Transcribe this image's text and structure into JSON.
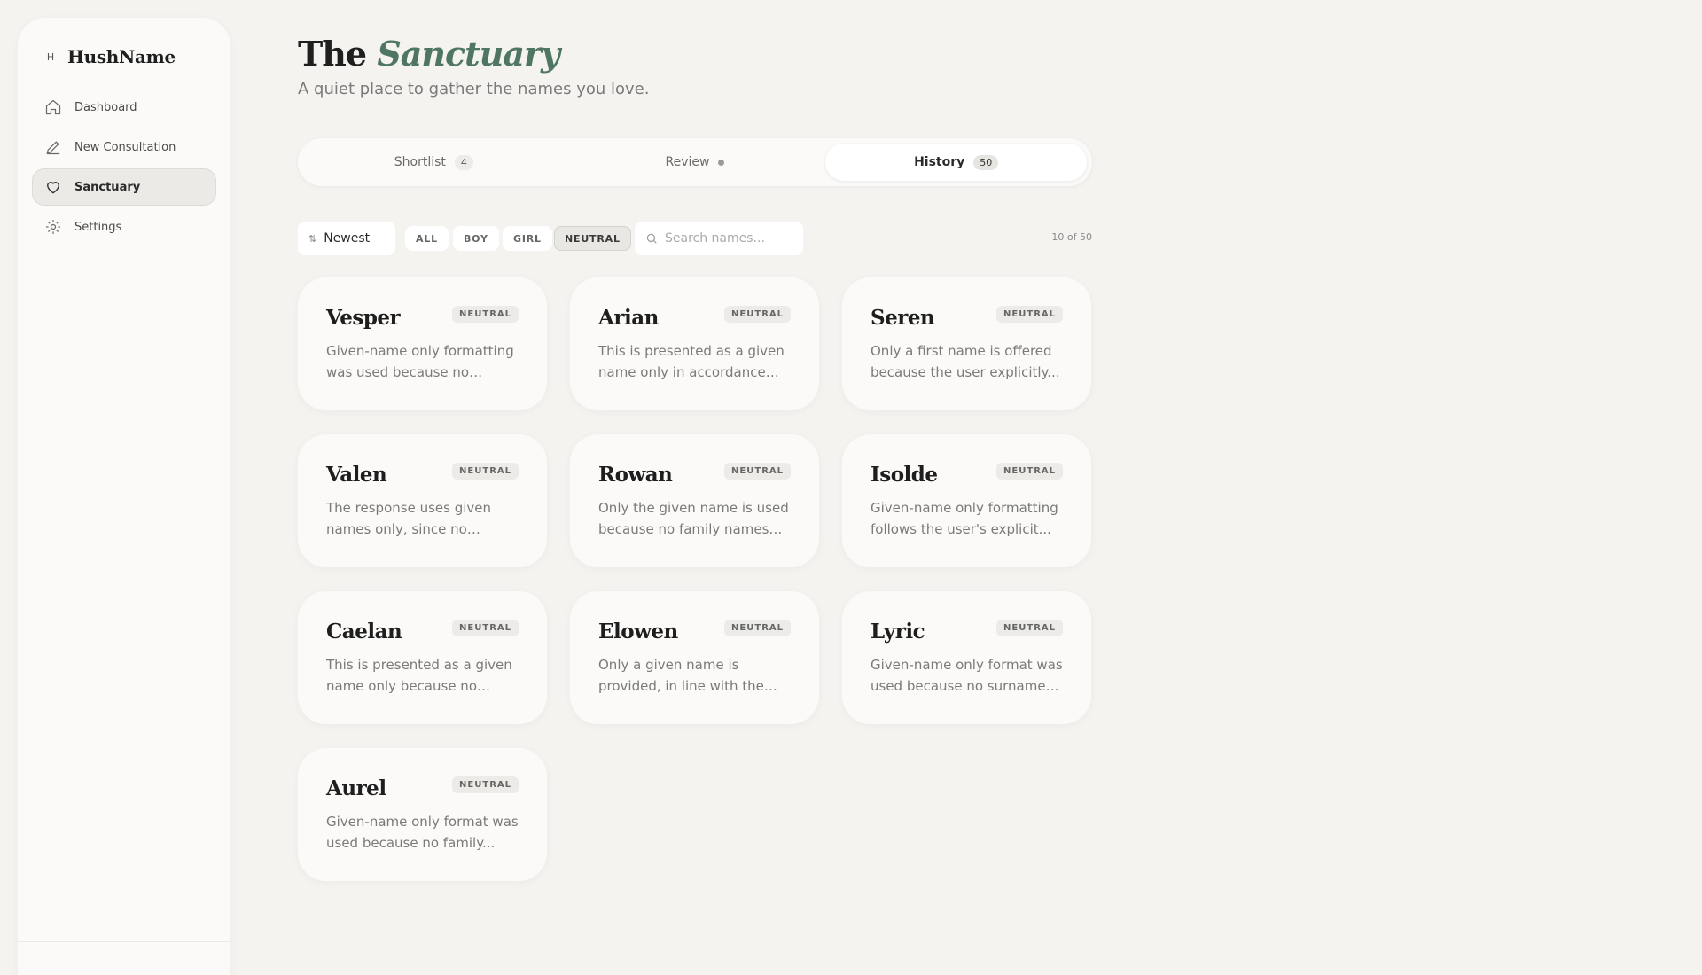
{
  "brand": {
    "mark": "H",
    "name": "HushName"
  },
  "nav": [
    {
      "label": "Dashboard",
      "icon": "home-icon"
    },
    {
      "label": "New Consultation",
      "icon": "pencil-icon"
    },
    {
      "label": "Sanctuary",
      "icon": "heart-icon",
      "active": true
    },
    {
      "label": "Settings",
      "icon": "gear-icon"
    }
  ],
  "header": {
    "title_prefix": "The",
    "title_accent": "Sanctuary",
    "subtitle": "A quiet place to gather the names you love."
  },
  "tabs": [
    {
      "label": "Shortlist",
      "count": "4"
    },
    {
      "label": "Review",
      "indicator": "dot"
    },
    {
      "label": "History",
      "count": "50",
      "active": true
    }
  ],
  "toolbar": {
    "sort_label": "Newest",
    "filters": [
      "ALL",
      "BOY",
      "GIRL",
      "NEUTRAL"
    ],
    "active_filter": "NEUTRAL",
    "search_placeholder": "Search names...",
    "count_text": "10 of 50"
  },
  "cards": [
    {
      "name": "Vesper",
      "badge": "NEUTRAL",
      "desc": "Given-name only formatting was used because no family..."
    },
    {
      "name": "Arian",
      "badge": "NEUTRAL",
      "desc": "This is presented as a given name only in accordance wit..."
    },
    {
      "name": "Seren",
      "badge": "NEUTRAL",
      "desc": "Only a first name is offered because the user explicitly..."
    },
    {
      "name": "Valen",
      "badge": "NEUTRAL",
      "desc": "The response uses given names only, since no family..."
    },
    {
      "name": "Rowan",
      "badge": "NEUTRAL",
      "desc": "Only the given name is used because no family names or..."
    },
    {
      "name": "Isolde",
      "badge": "NEUTRAL",
      "desc": "Given-name only formatting follows the user's explicit..."
    },
    {
      "name": "Caelan",
      "badge": "NEUTRAL",
      "desc": "This is presented as a given name only because no family..."
    },
    {
      "name": "Elowen",
      "badge": "NEUTRAL",
      "desc": "Only a given name is provided, in line with the user's..."
    },
    {
      "name": "Lyric",
      "badge": "NEUTRAL",
      "desc": "Given-name only format was used because no surnames o..."
    },
    {
      "name": "Aurel",
      "badge": "NEUTRAL",
      "desc": "Given-name only format was used because no family..."
    }
  ],
  "colors": {
    "background": "#f4f3f0",
    "panel": "#fbfaf8",
    "accent": "#4f7660"
  }
}
